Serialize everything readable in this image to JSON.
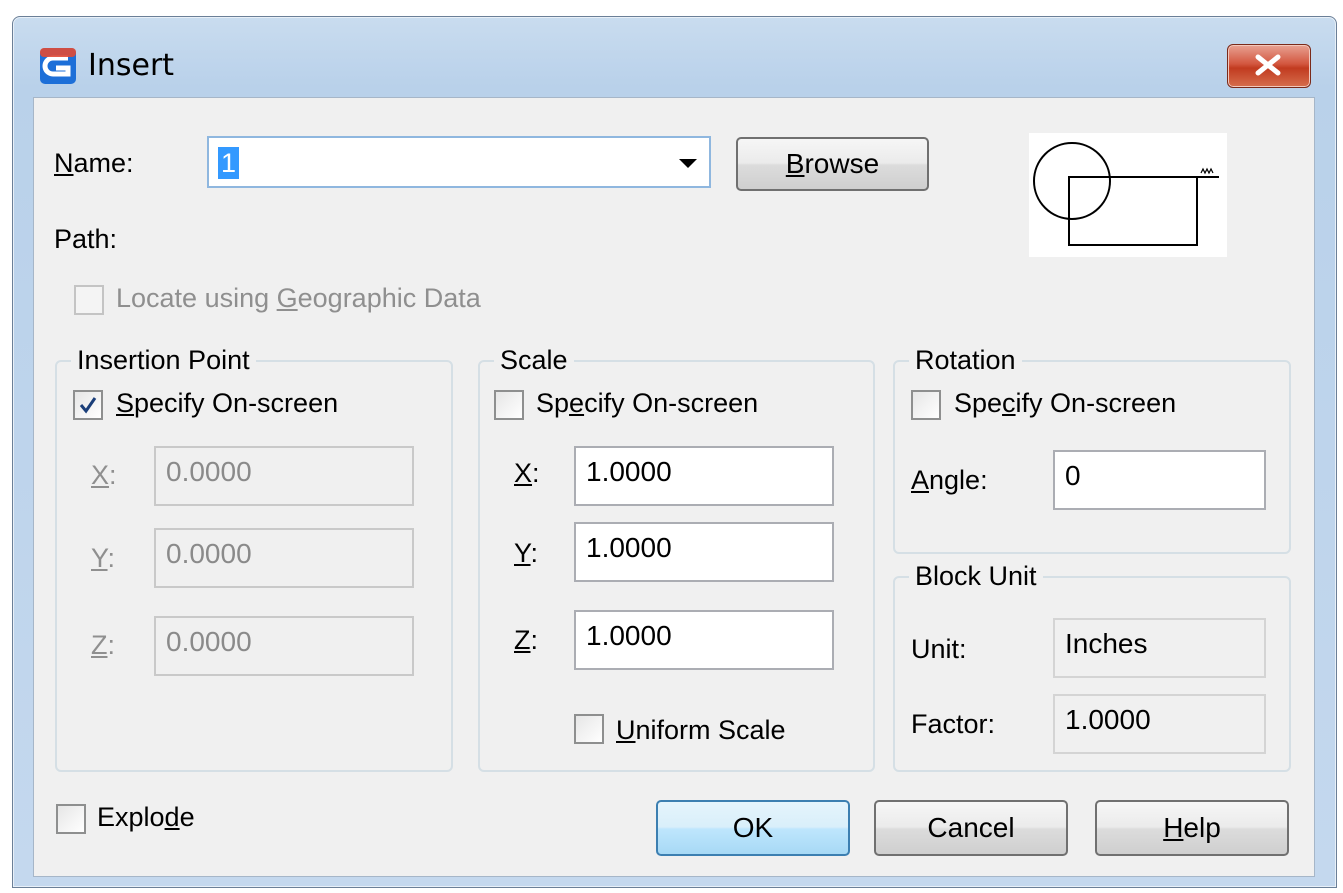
{
  "window": {
    "title": "Insert",
    "icon": "app-logo-icon",
    "close_icon": "close-icon"
  },
  "name_row": {
    "label": "Name:",
    "value": "1",
    "browse_label": "Browse"
  },
  "path": {
    "label": "Path:"
  },
  "geo": {
    "label": "Locate using Geographic Data",
    "checked": false,
    "enabled": false
  },
  "insertion_point": {
    "title": "Insertion Point",
    "specify_label": "Specify On-screen",
    "specify_checked": true,
    "x_label": "X:",
    "x_value": "0.0000",
    "y_label": "Y:",
    "y_value": "0.0000",
    "z_label": "Z:",
    "z_value": "0.0000"
  },
  "scale": {
    "title": "Scale",
    "specify_label": "Specify On-screen",
    "specify_checked": false,
    "x_label": "X:",
    "x_value": "1.0000",
    "y_label": "Y:",
    "y_value": "1.0000",
    "z_label": "Z:",
    "z_value": "1.0000",
    "uniform_label": "Uniform Scale",
    "uniform_checked": false
  },
  "rotation": {
    "title": "Rotation",
    "specify_label": "Specify On-screen",
    "specify_checked": false,
    "angle_label": "Angle:",
    "angle_value": "0"
  },
  "block_unit": {
    "title": "Block Unit",
    "unit_label": "Unit:",
    "unit_value": "Inches",
    "factor_label": "Factor:",
    "factor_value": "1.0000"
  },
  "explode": {
    "label": "Explode",
    "checked": false
  },
  "buttons": {
    "ok": "OK",
    "cancel": "Cancel",
    "help": "Help"
  }
}
